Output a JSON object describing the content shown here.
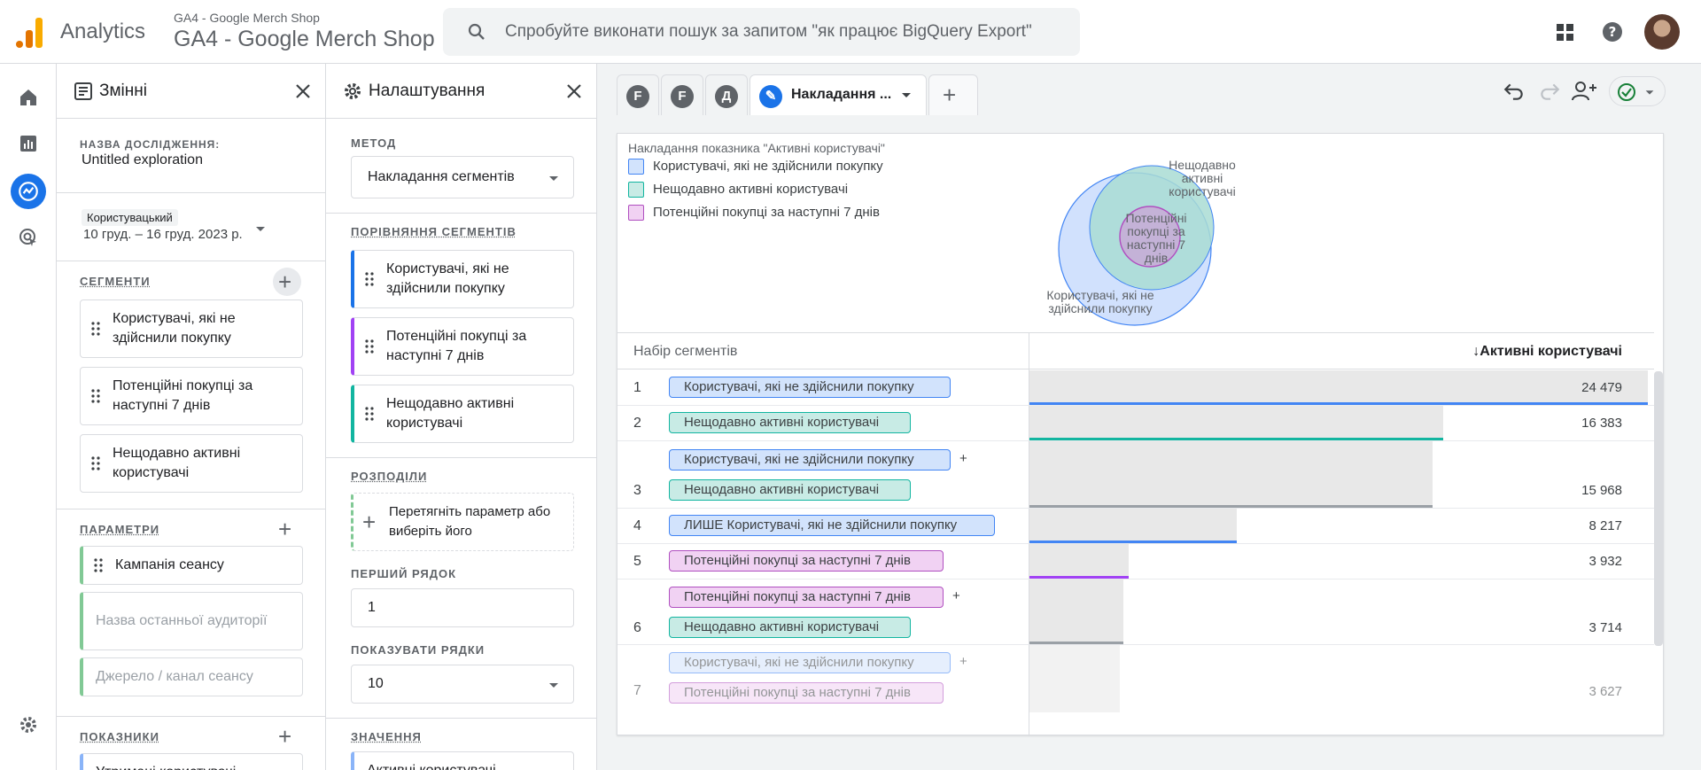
{
  "app": {
    "name": "Analytics",
    "property_small": "GA4 - Google Merch Shop",
    "property_big": "GA4 - Google Merch Shop"
  },
  "search": {
    "placeholder": "Спробуйте виконати пошук за запитом \"як працює BigQuery Export\""
  },
  "vars": {
    "title": "Змінні",
    "name_label": "НАЗВА ДОСЛІДЖЕННЯ:",
    "name_value": "Untitled exploration",
    "date_type": "Користувацький",
    "date_range": "10 груд. – 16 груд. 2023 р.",
    "segments_label": "СЕГМЕНТИ",
    "segments": [
      "Користувачі, які не здійснили покупку",
      "Потенційні покупці за наступні 7 днів",
      "Нещодавно активні користувачі"
    ],
    "params_label": "ПАРАМЕТРИ",
    "params": [
      "Кампанія сеансу",
      "Назва останньої аудиторії",
      "Джерело / канал сеансу"
    ],
    "metrics_label": "ПОКАЗНИКИ",
    "metrics_partial": "Утримані користувачі"
  },
  "settings": {
    "title": "Налаштування",
    "method_label": "МЕТОД",
    "method_value": "Накладання сегментів",
    "compare_label": "ПОРІВНЯННЯ СЕГМЕНТІВ",
    "compare": [
      "Користувачі, які не здійснили покупку",
      "Потенційні покупці за наступні 7 днів",
      "Нещодавно активні користувачі"
    ],
    "breakdowns_label": "РОЗПОДІЛИ",
    "breakdowns_drop": "Перетягніть параметр або виберіть його",
    "first_row_label": "ПЕРШИЙ РЯДОК",
    "first_row_value": "1",
    "show_rows_label": "ПОКАЗУВАТИ РЯДКИ",
    "show_rows_value": "10",
    "values_label": "ЗНАЧЕННЯ",
    "values_partial": "Активні користувачі"
  },
  "tabs": {
    "t1": "F",
    "t2": "F",
    "t3": "Д",
    "active": "Накладання ..."
  },
  "chart": {
    "legend_title": "Накладання показника \"Активні користувачі\"",
    "legend": [
      "Користувачі, які не здійснили покупку",
      "Нещодавно активні користувачі",
      "Потенційні покупці за наступні 7 днів"
    ],
    "venn_a": "Користувачі, які не здійснили покупку",
    "venn_b": "Нещодавно активні користувачі",
    "venn_c": "Потенційні покупці за наступні 7 днів"
  },
  "table": {
    "col1": "Набір сегментів",
    "col2": "Активні користувачі",
    "rows": [
      {
        "num": "1",
        "segs": [
          "Користувачі, які не здійснили покупку"
        ],
        "value": "24 479"
      },
      {
        "num": "2",
        "segs": [
          "Нещодавно активні користувачі"
        ],
        "value": "16 383"
      },
      {
        "num": "3",
        "segs": [
          "Користувачі, які не здійснили покупку",
          "Нещодавно активні користувачі"
        ],
        "value": "15 968"
      },
      {
        "num": "4",
        "segs": [
          "ЛИШЕ Користувачі, які не здійснили покупку"
        ],
        "value": "8 217"
      },
      {
        "num": "5",
        "segs": [
          "Потенційні покупці за наступні 7 днів"
        ],
        "value": "3 932"
      },
      {
        "num": "6",
        "segs": [
          "Потенційні покупці за наступні 7 днів",
          "Нещодавно активні користувачі"
        ],
        "value": "3 714"
      },
      {
        "num": "7",
        "segs": [
          "Користувачі, які не здійснили покупку",
          "Потенційні покупці за наступні 7 днів"
        ],
        "value": "3 627"
      }
    ],
    "plus": "+"
  },
  "colors": {
    "blue": "#4285f4",
    "teal": "#12b5a0",
    "purple": "#b04fc0",
    "gray": "#9aa0a6",
    "accent": "#1a73e8"
  }
}
